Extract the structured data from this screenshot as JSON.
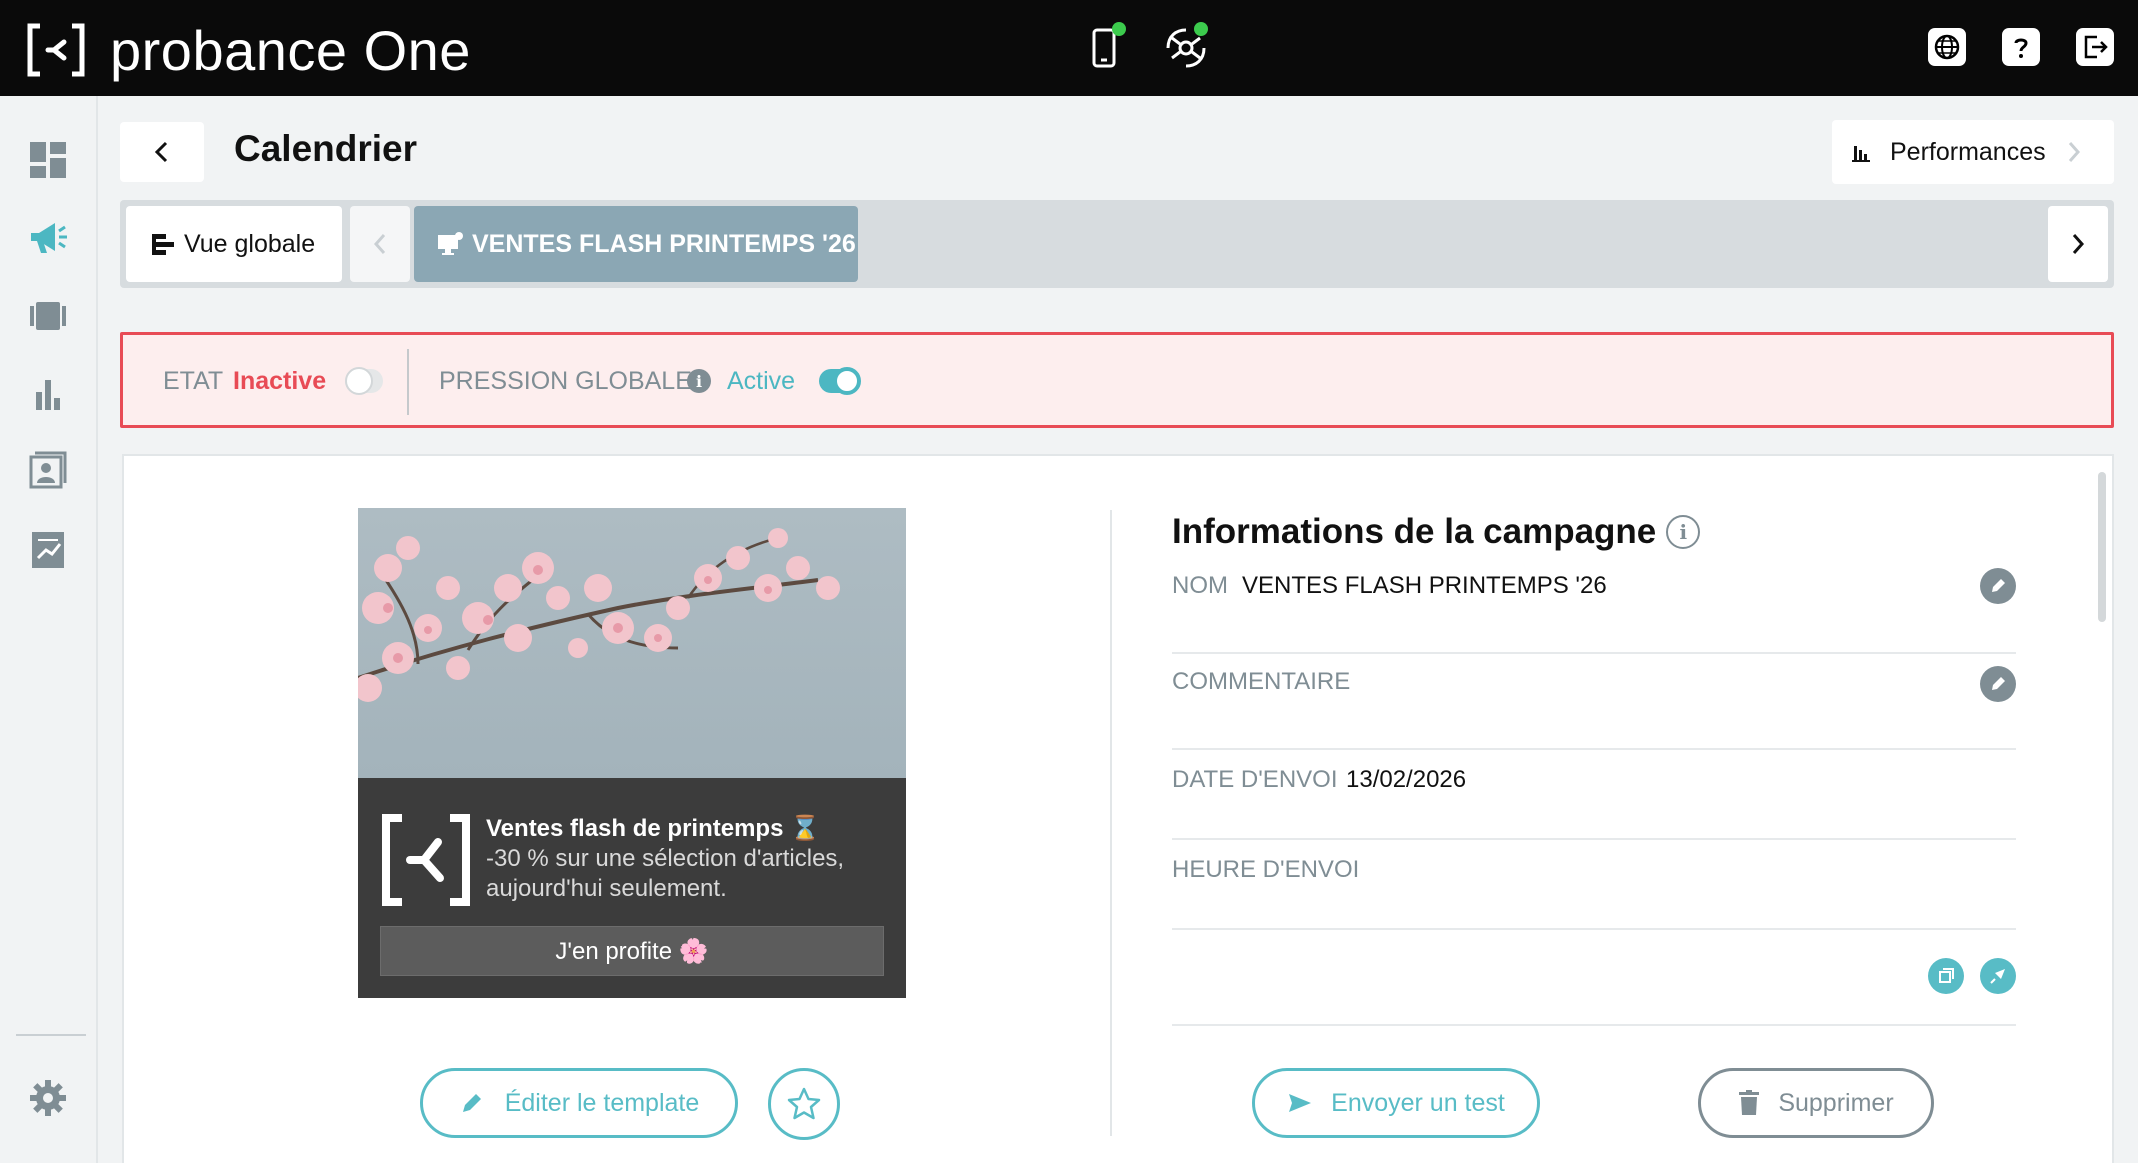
{
  "app": {
    "name": "probance One"
  },
  "header": {
    "title": "Calendrier",
    "performances_label": "Performances"
  },
  "tabs": {
    "global_label": "Vue globale",
    "active_label": "VENTES FLASH PRINTEMPS '26"
  },
  "state": {
    "etat_label": "ETAT",
    "etat_value": "Inactive",
    "pression_label": "PRESSION GLOBALE",
    "pression_value": "Active",
    "info_glyph": "i"
  },
  "preview": {
    "title": "Ventes flash de printemps ⌛",
    "text": "-30 % sur une sélection d'articles, aujourd'hui seulement.",
    "cta": "J'en profite 🌸"
  },
  "actions": {
    "edit_template": "Éditer le template",
    "send_test": "Envoyer un test",
    "delete": "Supprimer"
  },
  "info": {
    "title": "Informations de la campagne",
    "info_glyph": "i",
    "fields": [
      {
        "label": "NOM",
        "value": "VENTES FLASH PRINTEMPS '26"
      },
      {
        "label": "COMMENTAIRE",
        "value": ""
      },
      {
        "label": "DATE D'ENVOI",
        "value": "13/02/2026"
      },
      {
        "label": "HEURE D'ENVOI",
        "value": ""
      }
    ]
  },
  "colors": {
    "accent": "#58bcc6",
    "danger": "#e84b55",
    "muted": "#7f8d94",
    "tab_active": "#8ba7b4"
  },
  "icons": {
    "top_center": [
      "mobile-icon",
      "satellite-icon"
    ],
    "top_right": [
      "globe-icon",
      "help-icon",
      "logout-icon"
    ],
    "sidebar": [
      "dashboard-icon",
      "megaphone-icon",
      "cards-icon",
      "bar-chart-icon",
      "contacts-icon",
      "report-icon",
      "gear-icon"
    ]
  }
}
